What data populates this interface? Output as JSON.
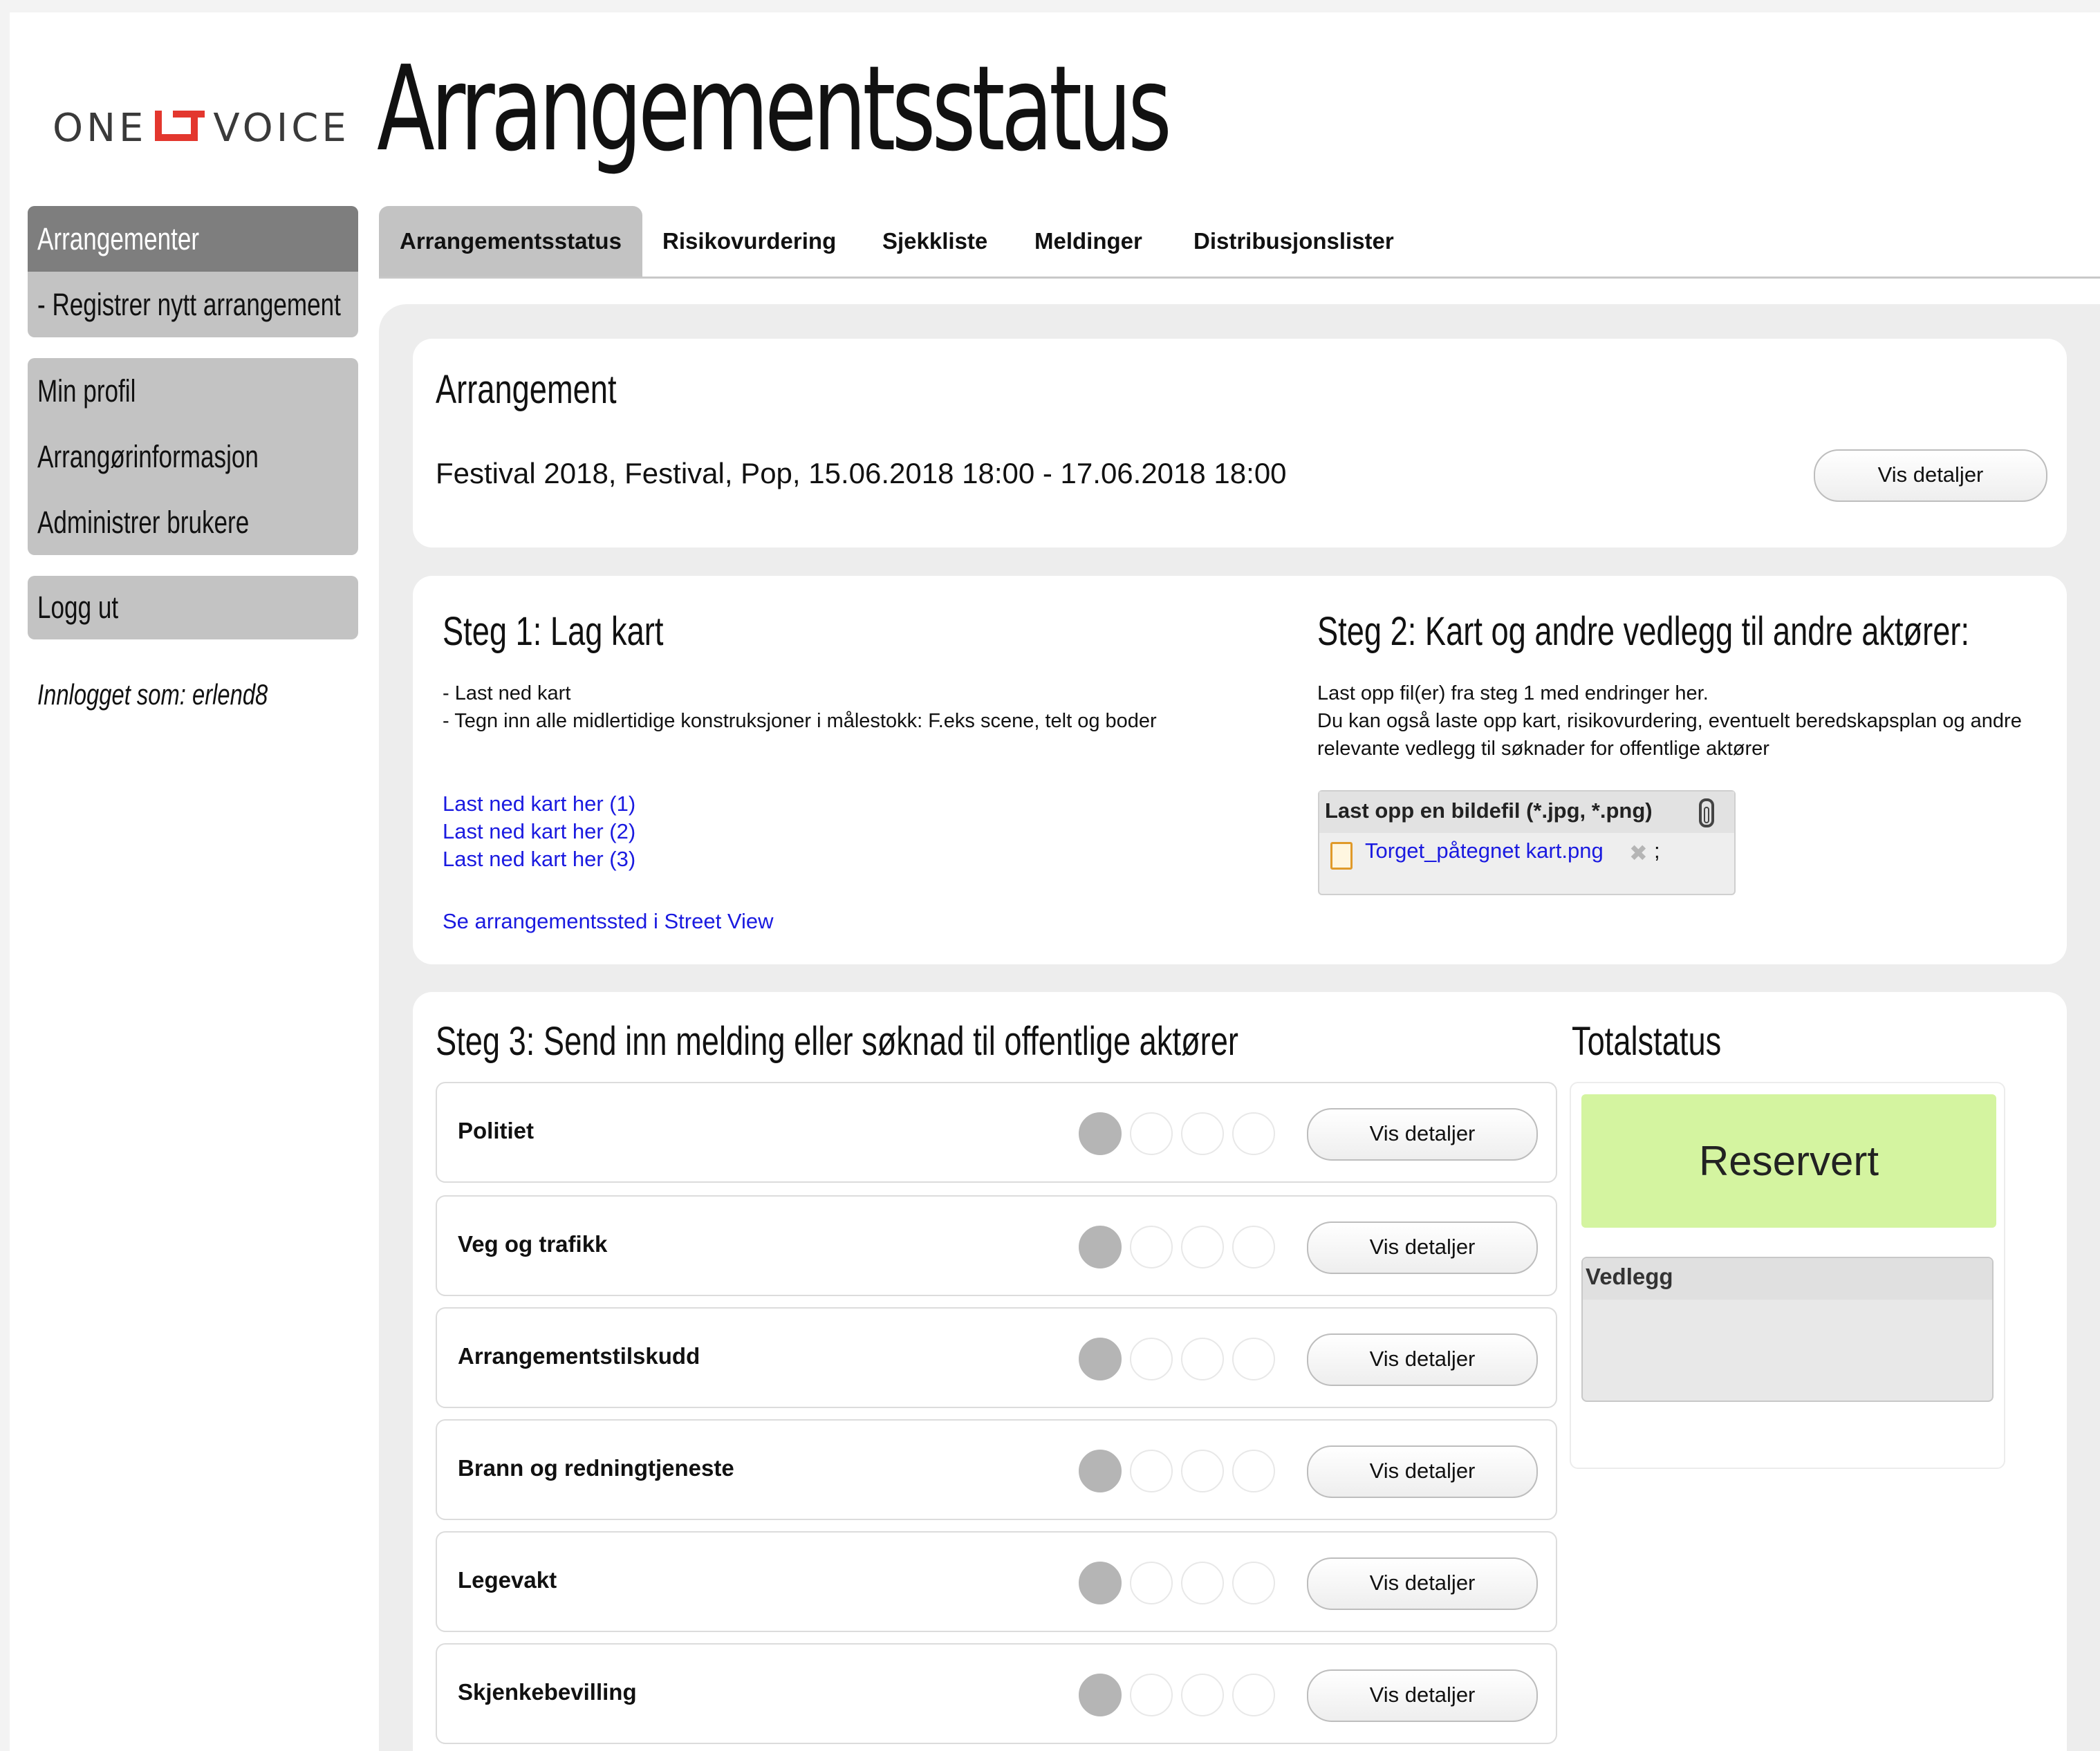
{
  "brand": {
    "logo_left": "ONE",
    "logo_right": "VOICE",
    "accent_color": "#e3372e"
  },
  "page_title": "Arrangementsstatus",
  "sidebar": {
    "group1": [
      {
        "label": "Arrangementer",
        "active": true
      },
      {
        "label": "- Registrer nytt arrangement",
        "active": false
      }
    ],
    "group2": [
      {
        "label": "Min profil"
      },
      {
        "label": "Arrangørinformasjon"
      },
      {
        "label": "Administrer brukere"
      }
    ],
    "group3": [
      {
        "label": "Logg ut"
      }
    ],
    "logged_in_as": "Innlogget som: erlend8"
  },
  "tabs": [
    {
      "label": "Arrangementsstatus",
      "active": true
    },
    {
      "label": "Risikovurdering",
      "active": false
    },
    {
      "label": "Sjekkliste",
      "active": false
    },
    {
      "label": "Meldinger",
      "active": false
    },
    {
      "label": "Distribusjonslister",
      "active": false
    }
  ],
  "event_card": {
    "title": "Arrangement",
    "summary": "Festival 2018, Festival, Pop, 15.06.2018 18:00 - 17.06.2018 18:00",
    "details_button": "Vis detaljer"
  },
  "step1": {
    "title": "Steg 1: Lag kart",
    "lines": [
      "- Last ned kart",
      "- Tegn inn alle midlertidige konstruksjoner i målestokk: F.eks scene, telt og boder"
    ],
    "links": [
      "Last ned kart her (1)",
      "Last ned kart her (2)",
      "Last ned kart her (3)"
    ],
    "street_view_link": "Se arrangementssted i Street View"
  },
  "step2": {
    "title": "Steg 2: Kart og andre vedlegg til andre aktører:",
    "lines": [
      "Last opp fil(er) fra steg 1 med endringer her.",
      "Du kan også laste opp kart, risikovurdering, eventuelt beredskapsplan og andre relevante vedlegg til søknader for offentlige aktører"
    ],
    "upload_label": "Last opp en bildefil (*.jpg, *.png)",
    "uploaded_file": "Torget_påtegnet kart.png",
    "separator": ";"
  },
  "step3": {
    "title": "Steg 3: Send inn melding eller søknad til offentlige aktører",
    "rows": [
      {
        "label": "Politiet",
        "status_level": 1,
        "button": "Vis detaljer"
      },
      {
        "label": "Veg og trafikk",
        "status_level": 1,
        "button": "Vis detaljer"
      },
      {
        "label": "Arrangementstilskudd",
        "status_level": 1,
        "button": "Vis detaljer"
      },
      {
        "label": "Brann og redningtjeneste",
        "status_level": 1,
        "button": "Vis detaljer"
      },
      {
        "label": "Legevakt",
        "status_level": 1,
        "button": "Vis detaljer"
      },
      {
        "label": "Skjenkebevilling",
        "status_level": 1,
        "button": "Vis detaljer"
      }
    ]
  },
  "totalstatus": {
    "title": "Totalstatus",
    "status": "Reservert",
    "status_color": "#d4f4a0",
    "attachments_label": "Vedlegg"
  }
}
